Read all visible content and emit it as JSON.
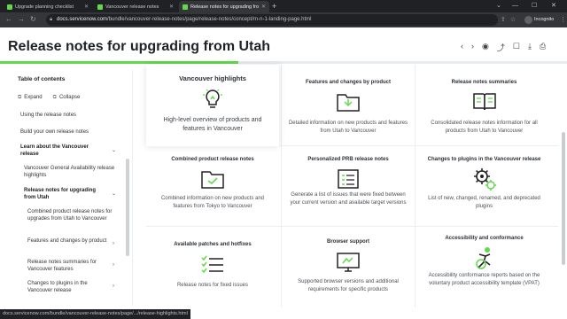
{
  "browser": {
    "tabs": [
      {
        "title": "Upgrade planning checklist",
        "active": false
      },
      {
        "title": "Vancouver release notes",
        "active": false
      },
      {
        "title": "Release notes for upgrading fro",
        "active": true
      }
    ],
    "url_domain": "docs.servicenow.com",
    "url_path": "/bundle/vancouver-release-notes/page/release-notes/concept/rn-n-1-landing-page.html",
    "incognito_label": "Incognito",
    "status_url": "docs.servicenow.com/bundle/vancouver-release-notes/page/.../release-highlights.html"
  },
  "header": {
    "title": "Release notes for upgrading from Utah",
    "progress_fraction": 0.42,
    "accent_color": "#62d84e"
  },
  "toc": {
    "title": "Table of contents",
    "expand_label": "Expand",
    "collapse_label": "Collapse",
    "items": [
      {
        "label": "Using the release notes"
      },
      {
        "label": "Build your own release notes"
      },
      {
        "label": "Learn about the Vancouver release"
      },
      {
        "label": "Vancouver General Availability release highlights"
      },
      {
        "label": "Release notes for upgrading from Utah"
      },
      {
        "label": "Combined product release notes for upgrades from Utah to Vancouver"
      },
      {
        "label": "Features and changes by product"
      },
      {
        "label": "Release notes summaries for Vancouver features"
      },
      {
        "label": "Changes to plugins in the Vancouver release"
      }
    ]
  },
  "cards": [
    {
      "title": "Vancouver highlights",
      "desc": "High-level overview of products and features in Vancouver",
      "icon": "lightbulb-icon"
    },
    {
      "title": "Features and changes by product",
      "desc": "Detailed information on new products and features from Utah to Vancouver",
      "icon": "folder-icon"
    },
    {
      "title": "Release notes summaries",
      "desc": "Consolidated release notes information for all products from Utah to Vancouver",
      "icon": "book-icon"
    },
    {
      "title": "Combined product release notes",
      "desc": "Combined information on new products and features from Tokyo to Vancouver",
      "icon": "folder-check-icon"
    },
    {
      "title": "Personalized PRB release notes",
      "desc": "Generate a list of issues that were fixed between your current version and available target versions",
      "icon": "list-icon"
    },
    {
      "title": "Changes to plugins in the Vancouver release",
      "desc": "List of new, changed, renamed, and deprecated plugins",
      "icon": "gears-icon"
    },
    {
      "title": "Available patches and hotfixes",
      "desc": "Release notes for fixed issues",
      "icon": "checklist-icon"
    },
    {
      "title": "Browser support",
      "desc": "Supported browser versions and additional requirements for specific products",
      "icon": "monitor-icon"
    },
    {
      "title": "Accessibility and conformance",
      "desc": "Accessibility conformance reports based on the voluntary product accessibility template (VPAT)",
      "icon": "accessibility-icon"
    }
  ]
}
